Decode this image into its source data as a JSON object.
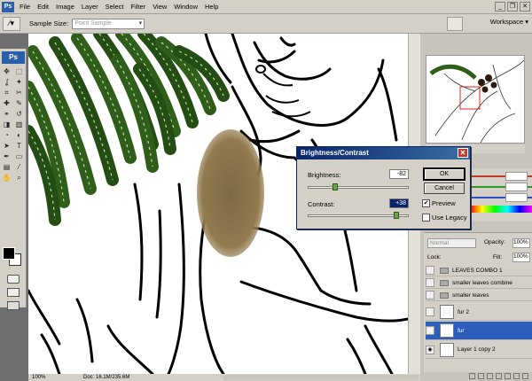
{
  "menu": {
    "items": [
      "File",
      "Edit",
      "Image",
      "Layer",
      "Select",
      "Filter",
      "View",
      "Window",
      "Help"
    ],
    "app_badge": "Ps"
  },
  "options_bar": {
    "sample_size_label": "Sample Size:",
    "sample_size_value": "Point Sample",
    "workspace_label": "Workspace ▾"
  },
  "tools": {
    "logo": "Ps",
    "icons": [
      "move-icon",
      "marquee-icon",
      "lasso-icon",
      "magic-wand-icon",
      "crop-icon",
      "slice-icon",
      "healing-icon",
      "brush-icon",
      "stamp-icon",
      "history-brush-icon",
      "eraser-icon",
      "gradient-icon",
      "blur-icon",
      "dodge-icon",
      "path-select-icon",
      "type-icon",
      "pen-icon",
      "shape-icon",
      "notes-icon",
      "eyedropper-icon",
      "hand-icon",
      "zoom-icon"
    ],
    "glyphs": [
      "✥",
      "⬚",
      "ʆ",
      "✦",
      "⌗",
      "✂",
      "✚",
      "✎",
      "⚭",
      "↺",
      "◨",
      "▥",
      "◔",
      "◐",
      "➤",
      "T",
      "✒",
      "▭",
      "▤",
      "⁄",
      "✋",
      "⌕"
    ]
  },
  "status": {
    "zoom": "100%",
    "doc": "Doc: 16.1M/235.6M"
  },
  "dialog": {
    "title": "Brightness/Contrast",
    "brightness_label": "Brightness:",
    "brightness_value": "-82",
    "contrast_label": "Contrast:",
    "contrast_value": "+38",
    "ok_label": "OK",
    "cancel_label": "Cancel",
    "preview_label": "Preview",
    "preview_checked": true,
    "legacy_label": "Use Legacy",
    "legacy_checked": false,
    "brightness_level": 0.27,
    "contrast_level": 0.88
  },
  "layers": {
    "blend_mode": "Normal",
    "opacity_label": "Opacity:",
    "opacity_value": "100%",
    "lock_label": "Lock:",
    "fill_label": "Fill:",
    "fill_value": "100%",
    "rows": [
      {
        "name": "LEAVES COMBO 1",
        "type": "group",
        "visible": false,
        "selected": false
      },
      {
        "name": "smaller leaves combine",
        "type": "group",
        "visible": false,
        "selected": false
      },
      {
        "name": "smaller leaves",
        "type": "group",
        "visible": false,
        "selected": false
      },
      {
        "name": "fur 2",
        "type": "layer",
        "visible": false,
        "selected": false
      },
      {
        "name": "fur",
        "type": "layer",
        "visible": true,
        "selected": true
      },
      {
        "name": "Layer 1 copy 2",
        "type": "layer",
        "visible": true,
        "selected": false
      }
    ]
  },
  "colors": {
    "selection": "#2e5ebd",
    "leaf_green": "#2f5e1a",
    "fur_brown": "#8a7348"
  }
}
